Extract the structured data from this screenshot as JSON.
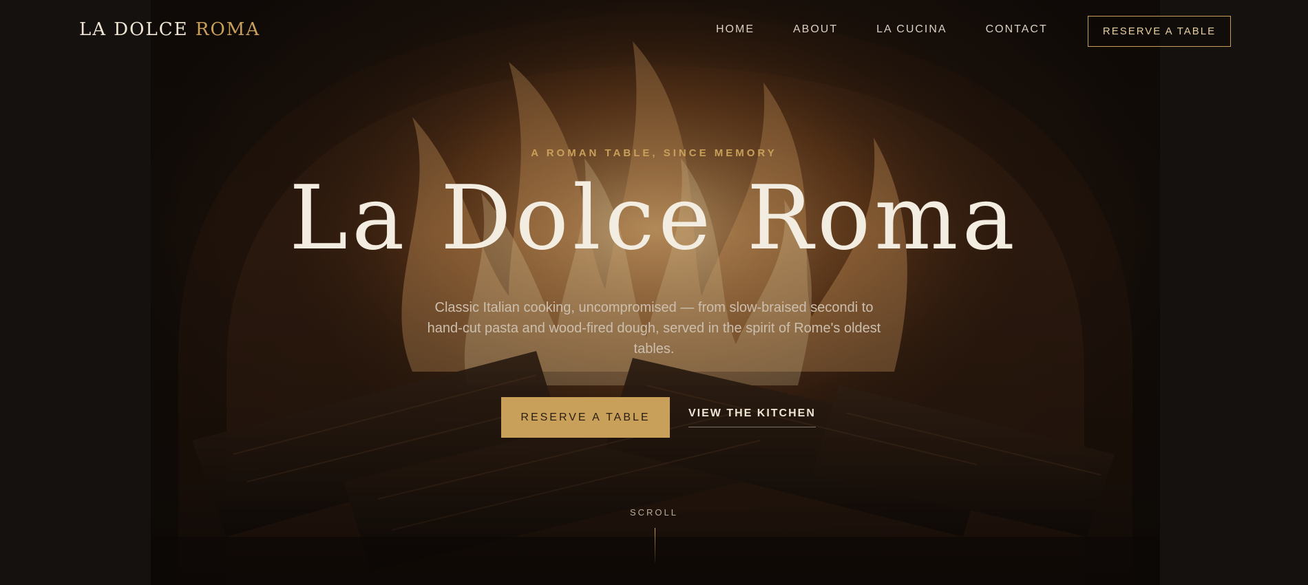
{
  "brand": {
    "name_part1": "LA DOLCE",
    "name_part2": "ROMA",
    "accent_color": "#c9a05a"
  },
  "nav": {
    "links": [
      "HOME",
      "ABOUT",
      "LA CUCINA",
      "CONTACT"
    ],
    "cta_label": "RESERVE A TABLE"
  },
  "hero": {
    "eyebrow": "A ROMAN TABLE, SINCE MEMORY",
    "title": "La Dolce Roma",
    "subtitle": "Classic Italian cooking, uncompromised — from slow-braised secondi to hand-cut pasta and wood-fired dough, served in the spirit of Rome's oldest tables.",
    "primary_button": "RESERVE A TABLE",
    "secondary_button": "VIEW THE KITCHEN",
    "background": "wood-fired-oven-flames-image"
  },
  "scroll": {
    "label": "SCROLL"
  }
}
